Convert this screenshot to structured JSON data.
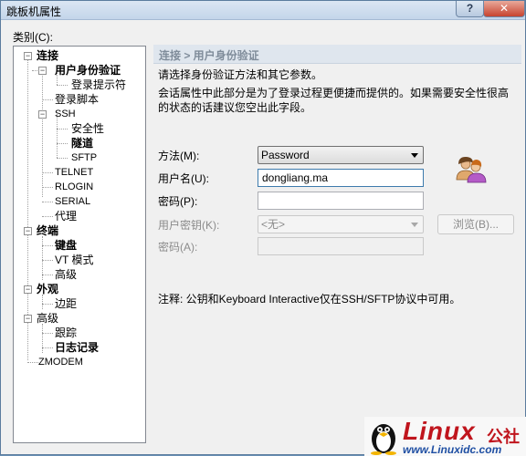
{
  "window": {
    "title": "跳板机属性",
    "help_glyph": "?",
    "close_glyph": "✕"
  },
  "category_label": "类别(C):",
  "tree": [
    {
      "id": "lianjie",
      "label": "连接",
      "bold": true
    },
    {
      "id": "yonghu",
      "label": "用户身份验证",
      "bold": true
    },
    {
      "id": "denglutishi",
      "label": "登录提示符",
      "bold": false
    },
    {
      "id": "denglujiaoben",
      "label": "登录脚本",
      "bold": false
    },
    {
      "id": "ssh",
      "label": "SSH",
      "bold": false
    },
    {
      "id": "anquanxing",
      "label": "安全性",
      "bold": false
    },
    {
      "id": "suidao",
      "label": "隧道",
      "bold": true
    },
    {
      "id": "sftp",
      "label": "SFTP",
      "bold": false
    },
    {
      "id": "telnet",
      "label": "TELNET",
      "bold": false
    },
    {
      "id": "rlogin",
      "label": "RLOGIN",
      "bold": false
    },
    {
      "id": "serial",
      "label": "SERIAL",
      "bold": false
    },
    {
      "id": "daili",
      "label": "代理",
      "bold": false
    },
    {
      "id": "zhongduan",
      "label": "终端",
      "bold": true
    },
    {
      "id": "jianpan",
      "label": "键盘",
      "bold": true
    },
    {
      "id": "vt",
      "label": "VT 模式",
      "bold": false
    },
    {
      "id": "gaoji1",
      "label": "高级",
      "bold": false
    },
    {
      "id": "waiguan",
      "label": "外观",
      "bold": true
    },
    {
      "id": "bianju",
      "label": "边距",
      "bold": false
    },
    {
      "id": "gaoji2",
      "label": "高级",
      "bold": false
    },
    {
      "id": "genzong",
      "label": "跟踪",
      "bold": false
    },
    {
      "id": "rizhi",
      "label": "日志记录",
      "bold": true
    },
    {
      "id": "zmodem",
      "label": "ZMODEM",
      "bold": false
    }
  ],
  "panel": {
    "header": "连接 > 用户身份验证",
    "desc1": "请选择身份验证方法和其它参数。",
    "desc2": "会话属性中此部分是为了登录过程更便捷而提供的。如果需要安全性很高",
    "desc3": "的状态的话建议您空出此字段。",
    "method_label": "方法(M):",
    "method_value": "Password",
    "username_label": "用户名(U):",
    "username_value": "dongliang.ma",
    "password_label": "密码(P):",
    "password_value": "",
    "userkey_label": "用户密钥(K):",
    "userkey_value": "<无>",
    "browse_label": "浏览(B)...",
    "passphrase_label": "密码(A):",
    "passphrase_value": "",
    "note": "注释: 公钥和Keyboard Interactive仅在SSH/SFTP协议中可用。"
  },
  "watermark": {
    "logo": "Linux",
    "cn": "公社",
    "url": "www.Linuxidc.com"
  }
}
